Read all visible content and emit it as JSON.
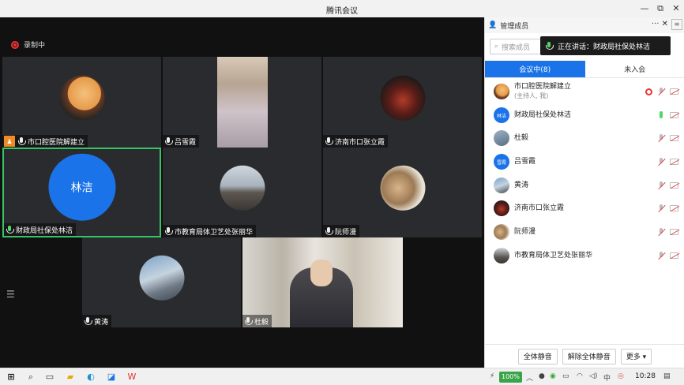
{
  "window": {
    "title": "腾讯会议",
    "minimize": "—",
    "restore": "⧉",
    "close": "✕"
  },
  "video": {
    "recording_label": "录制中",
    "tiles": [
      {
        "name": "市口腔医院解建立",
        "host": true
      },
      {
        "name": "吕雪霞"
      },
      {
        "name": "济南市口张立霞"
      },
      {
        "name": "财政局社保处林洁",
        "avatar_text": "林洁",
        "active": true
      },
      {
        "name": "市教育局体卫艺处张丽华"
      },
      {
        "name": "阮师漫"
      },
      {
        "name": "黄涛"
      },
      {
        "name": "杜毅"
      }
    ]
  },
  "panel": {
    "title": "管理成员",
    "more": "···",
    "close": "✕",
    "sidebar_toggle": "≡",
    "search_placeholder": "搜索成员",
    "speaking_label": "正在讲话：财政局社保处林洁",
    "tabs": [
      "会议中(8)",
      "未入会"
    ],
    "members": [
      {
        "name": "市口腔医院解建立",
        "sub": "(主持人, 我)",
        "avatar": "photo",
        "recording": true
      },
      {
        "name": "财政局社保处林洁",
        "avatar_text": "林洁",
        "mic_on": true
      },
      {
        "name": "杜毅",
        "avatar": "photo"
      },
      {
        "name": "吕雪霞",
        "avatar_text": "雪霞"
      },
      {
        "name": "黄涛",
        "avatar": "photo"
      },
      {
        "name": "济南市口张立霞",
        "avatar": "photo"
      },
      {
        "name": "阮师漫",
        "avatar": "photo"
      },
      {
        "name": "市教育局体卫艺处张丽华",
        "avatar": "photo"
      }
    ],
    "buttons": {
      "mute_all": "全体静音",
      "unmute_all": "解除全体静音",
      "more": "更多 ▾"
    }
  },
  "taskbar": {
    "battery": "100%",
    "time": "10:28"
  }
}
